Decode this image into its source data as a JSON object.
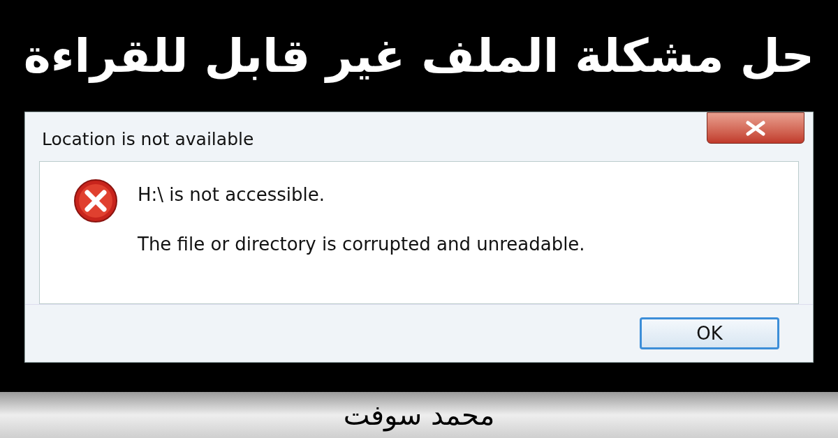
{
  "headline": "حل مشكلة الملف غير قابل للقراءة",
  "dialog": {
    "title": "Location is not available",
    "message": "H:\\ is not accessible.",
    "detail": "The file or directory is corrupted and unreadable.",
    "buttons": [
      {
        "label": "OK",
        "selected": true
      }
    ]
  },
  "footer": "محمد سوفت"
}
